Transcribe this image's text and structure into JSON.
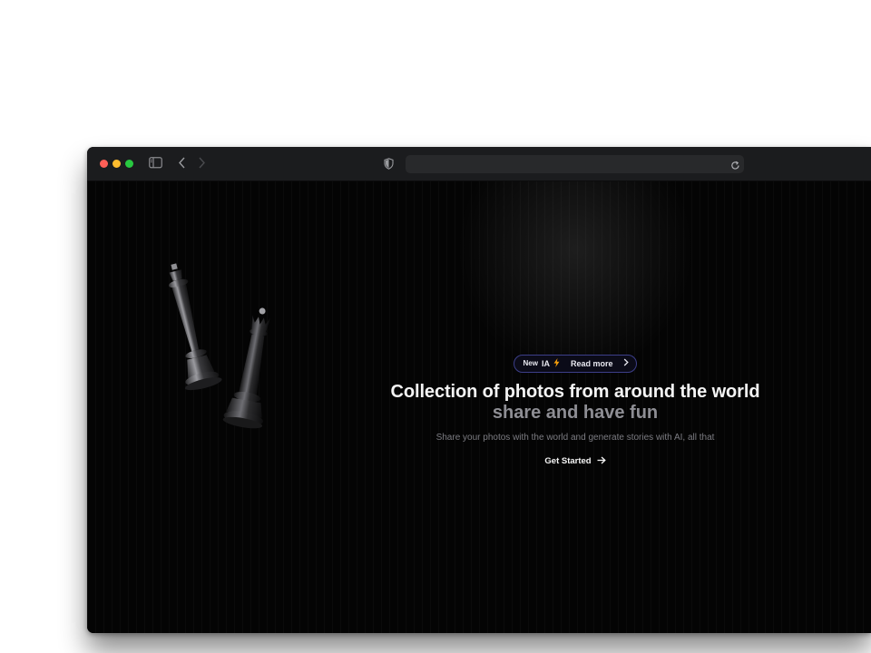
{
  "badge": {
    "new_label": "New",
    "ia_label": "IA",
    "read_more_label": "Read more",
    "bolt_icon": "lightning-bolt-icon",
    "bolt_color": "#f59e0b",
    "border_color": "#3d3f8a"
  },
  "hero": {
    "headline": "Collection of photos from around the world",
    "subline": "share and have fun",
    "description": "Share your photos with the world and generate stories with AI, all that"
  },
  "cta": {
    "label": "Get Started",
    "icon": "arrow-right-icon"
  },
  "browser": {
    "traffic_lights": [
      "#ff5f57",
      "#febc2e",
      "#28c840"
    ],
    "address_value": ""
  },
  "colors": {
    "page_background": "#ffffff",
    "content_background": "#040404",
    "titlebar": "#1b1c1e",
    "headline": "#f4f4f4",
    "subline": "#8e8e94"
  }
}
